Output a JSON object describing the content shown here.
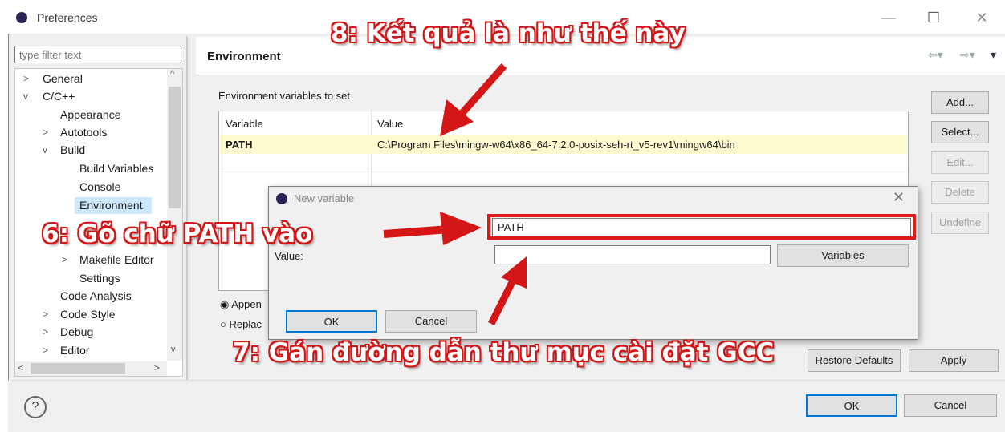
{
  "window": {
    "title": "Preferences",
    "minimize": "—",
    "maximize": "☐",
    "close": "✕"
  },
  "sidebar": {
    "filter_placeholder": "type filter text",
    "tree": [
      {
        "label": "General",
        "toggle": ">"
      },
      {
        "label": "C/C++",
        "toggle": "v"
      },
      {
        "label": "Appearance",
        "toggle": ""
      },
      {
        "label": "Autotools",
        "toggle": ">"
      },
      {
        "label": "Build",
        "toggle": "v"
      },
      {
        "label": "Build Variables",
        "toggle": ""
      },
      {
        "label": "Console",
        "toggle": ""
      },
      {
        "label": "Environment",
        "toggle": ""
      },
      {
        "label": "Makefile Editor",
        "toggle": ">"
      },
      {
        "label": "Settings",
        "toggle": ""
      },
      {
        "label": "Code Analysis",
        "toggle": ""
      },
      {
        "label": "Code Style",
        "toggle": ">"
      },
      {
        "label": "Debug",
        "toggle": ">"
      },
      {
        "label": "Editor",
        "toggle": ">"
      }
    ]
  },
  "page": {
    "title": "Environment",
    "group_label": "Environment variables to set",
    "columns": [
      "Variable",
      "Value"
    ],
    "rows": [
      {
        "variable": "PATH",
        "value": "C:\\Program Files\\mingw-w64\\x86_64-7.2.0-posix-seh-rt_v5-rev1\\mingw64\\bin"
      }
    ],
    "buttons": {
      "add": "Add...",
      "select": "Select...",
      "edit": "Edit...",
      "delete": "Delete",
      "undefine": "Undefine"
    },
    "radio_append": "Appen",
    "radio_replace": "Replac",
    "restore_defaults": "Restore Defaults",
    "apply": "Apply"
  },
  "dialog": {
    "title": "New variable",
    "close": "✕",
    "name_value": "PATH",
    "value_label": "Value:",
    "value_value": "",
    "variables_button": "Variables",
    "ok": "OK",
    "cancel": "Cancel"
  },
  "footer": {
    "help": "?",
    "ok": "OK",
    "cancel": "Cancel"
  },
  "annotations": {
    "step8": "8: Kết quả là như thế này",
    "step6": "6: Gõ chữ PATH vào",
    "step7": "7: Gán đường dẫn thư mục cài đặt GCC"
  },
  "colors": {
    "annotation": "#d41616",
    "selection": "#cce8ff",
    "row_highlight": "#fffbd0"
  }
}
